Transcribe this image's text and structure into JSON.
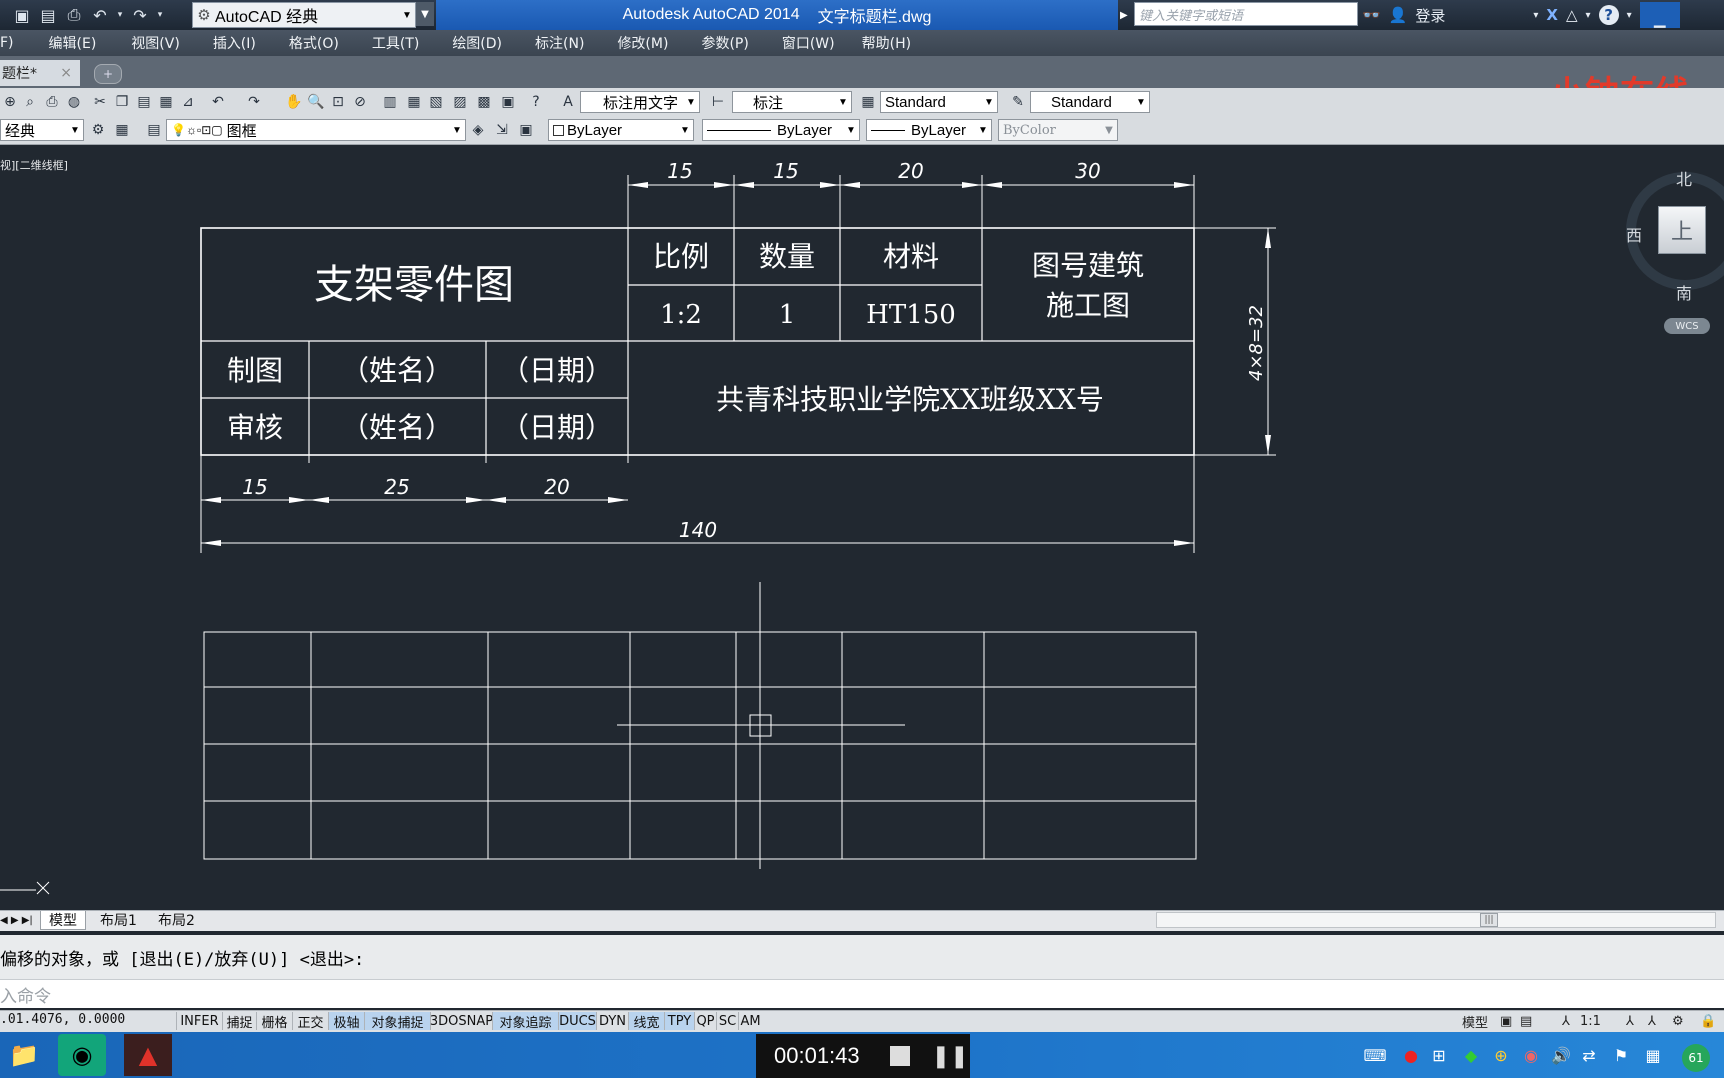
{
  "titlebar": {
    "workspace": "AutoCAD 经典",
    "app_title": "Autodesk AutoCAD 2014",
    "file_name": "文字标题栏.dwg",
    "search_placeholder": "键入关键字或短语",
    "login": "登录"
  },
  "menu": [
    "F)",
    "编辑(E)",
    "视图(V)",
    "插入(I)",
    "格式(O)",
    "工具(T)",
    "绘图(D)",
    "标注(N)",
    "修改(M)",
    "参数(P)",
    "窗口(W)",
    "帮助(H)"
  ],
  "doc_tab": {
    "label": "题栏*",
    "close": "×",
    "new": "+"
  },
  "watermark": "小钟在线",
  "toolbar1": {
    "text_style": "标注用文字",
    "dim_style": "标注",
    "table_style": "Standard",
    "multileader_style": "Standard"
  },
  "toolbar2": {
    "workspace_short": "经典",
    "layer": "图框",
    "color": "ByLayer",
    "linetype": "ByLayer",
    "lineweight": "ByLayer",
    "plotstyle": "ByColor"
  },
  "viewport_label": "视][二维线框]",
  "title_block": {
    "part_name": "支架零件图",
    "headers": [
      "比例",
      "数量",
      "材料"
    ],
    "values": [
      "1:2",
      "1",
      "HT150"
    ],
    "drawing_no": [
      "图号建筑",
      "施工图"
    ],
    "rows": [
      [
        "制图",
        "（姓名）",
        "（日期）"
      ],
      [
        "审核",
        "（姓名）",
        "（日期）"
      ]
    ],
    "school": "共青科技职业学院XX班级XX号"
  },
  "dimensions": {
    "top": [
      "15",
      "15",
      "20",
      "30"
    ],
    "bottom": [
      "15",
      "25",
      "20"
    ],
    "total": "140",
    "height": "4×8=32"
  },
  "viewcube": {
    "north": "北",
    "west": "西",
    "south": "南",
    "top": "上",
    "wcs": "WCS"
  },
  "layout_tabs": [
    "模型",
    "布局1",
    "布局2"
  ],
  "command": {
    "history": "偏移的对象，或 [退出(E)/放弃(U)] <退出>:",
    "input_placeholder": "入命令"
  },
  "status": {
    "coords": ".01.4076, 0.0000",
    "buttons": [
      "INFER",
      "捕捉",
      "栅格",
      "正交",
      "极轴",
      "对象捕捉",
      "3DOSNAP",
      "对象追踪",
      "DUCS",
      "DYN",
      "线宽",
      "TPY",
      "QP",
      "SC",
      "AM"
    ],
    "active": [
      "极轴",
      "对象捕捉",
      "对象追踪",
      "DUCS",
      "线宽",
      "TPY"
    ],
    "model": "模型",
    "scale": "1:1"
  },
  "taskbar": {
    "timer": "00:01:43",
    "badge": "61"
  }
}
